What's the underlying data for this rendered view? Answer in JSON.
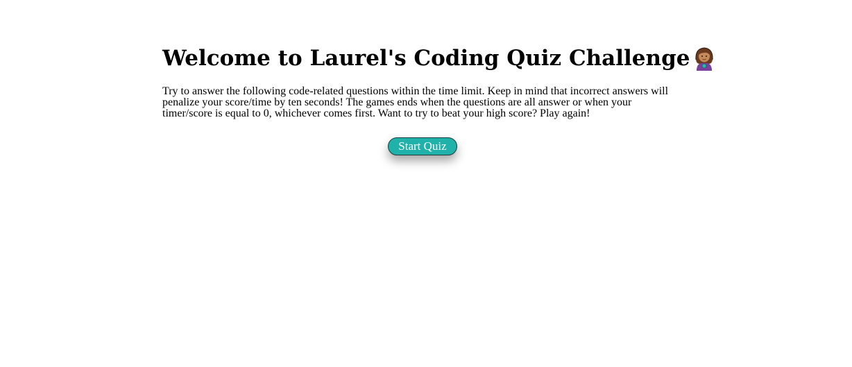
{
  "header": {
    "title": "Welcome to Laurel's Coding Quiz Challenge",
    "title_icon": "woman-genie-icon"
  },
  "intro": {
    "text": "Try to answer the following code-related questions within the time limit. Keep in mind that incorrect answers will penalize your score/time by ten seconds! The games ends when the questions are all answer or when your timer/score is equal to 0, whichever comes first. Want to try to beat your high score? Play again!"
  },
  "actions": {
    "start_label": "Start Quiz"
  },
  "colors": {
    "button_bg": "#20b2aa",
    "button_text": "#ffffff",
    "text": "#000000"
  }
}
